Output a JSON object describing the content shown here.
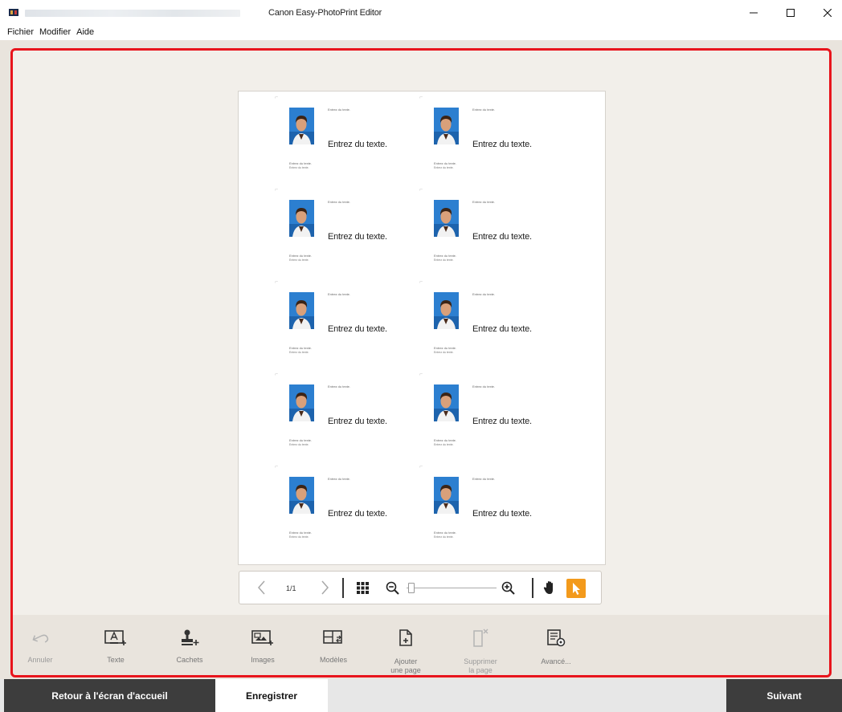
{
  "window": {
    "title": "Canon Easy-PhotoPrint Editor",
    "minimize_icon": "minimize-icon",
    "maximize_icon": "maximize-icon",
    "close_icon": "close-icon"
  },
  "menu": [
    "Fichier",
    "Modifier",
    "Aide"
  ],
  "page": {
    "cards": [
      {
        "small_top": "Entrez du texte.",
        "main_text": "Entrez du texte.",
        "line1": "Entrez du texte.",
        "line2": "Entrez du texte."
      },
      {
        "small_top": "Entrez du texte.",
        "main_text": "Entrez du texte.",
        "line1": "Entrez du texte.",
        "line2": "Entrez du texte."
      },
      {
        "small_top": "Entrez du texte.",
        "main_text": "Entrez du texte.",
        "line1": "Entrez du texte.",
        "line2": "Entrez du texte."
      },
      {
        "small_top": "Entrez du texte.",
        "main_text": "Entrez du texte.",
        "line1": "Entrez du texte.",
        "line2": "Entrez du texte."
      },
      {
        "small_top": "Entrez du texte.",
        "main_text": "Entrez du texte.",
        "line1": "Entrez du texte.",
        "line2": "Entrez du texte."
      },
      {
        "small_top": "Entrez du texte.",
        "main_text": "Entrez du texte.",
        "line1": "Entrez du texte.",
        "line2": "Entrez du texte."
      },
      {
        "small_top": "Entrez du texte.",
        "main_text": "Entrez du texte.",
        "line1": "Entrez du texte.",
        "line2": "Entrez du texte."
      },
      {
        "small_top": "Entrez du texte.",
        "main_text": "Entrez du texte.",
        "line1": "Entrez du texte.",
        "line2": "Entrez du texte."
      },
      {
        "small_top": "Entrez du texte.",
        "main_text": "Entrez du texte.",
        "line1": "Entrez du texte.",
        "line2": "Entrez du texte."
      },
      {
        "small_top": "Entrez du texte.",
        "main_text": "Entrez du texte.",
        "line1": "Entrez du texte.",
        "line2": "Entrez du texte."
      }
    ]
  },
  "navigation": {
    "page_indicator": "1/1",
    "icons": [
      "chevron-left-icon",
      "chevron-right-icon",
      "grid-view-icon",
      "zoom-out-icon",
      "zoom-in-icon",
      "hand-icon",
      "pointer-icon"
    ],
    "zoom_level": 0.05,
    "active_tool": "pointer"
  },
  "tools": [
    {
      "label": "Annuler",
      "icon": "undo-icon",
      "enabled": false
    },
    {
      "label": "Texte",
      "icon": "text-icon",
      "enabled": true
    },
    {
      "label": "Cachets",
      "icon": "stamp-icon",
      "enabled": true
    },
    {
      "label": "Images",
      "icon": "images-icon",
      "enabled": true
    },
    {
      "label": "Modèles",
      "icon": "templates-icon",
      "enabled": true
    },
    {
      "label": "Ajouter",
      "label2": "une page",
      "icon": "add-page-icon",
      "enabled": true
    },
    {
      "label": "Supprimer",
      "label2": "la page",
      "icon": "delete-page-icon",
      "enabled": false
    },
    {
      "label": "Avancé...",
      "icon": "advanced-icon",
      "enabled": true
    }
  ],
  "footer": {
    "home_label": "Retour à l'écran d'accueil",
    "save_label": "Enregistrer",
    "next_label": "Suivant"
  },
  "colors": {
    "highlight": "#e8141c",
    "accent": "#f39a1c",
    "dark_button": "#3d3d3d"
  }
}
